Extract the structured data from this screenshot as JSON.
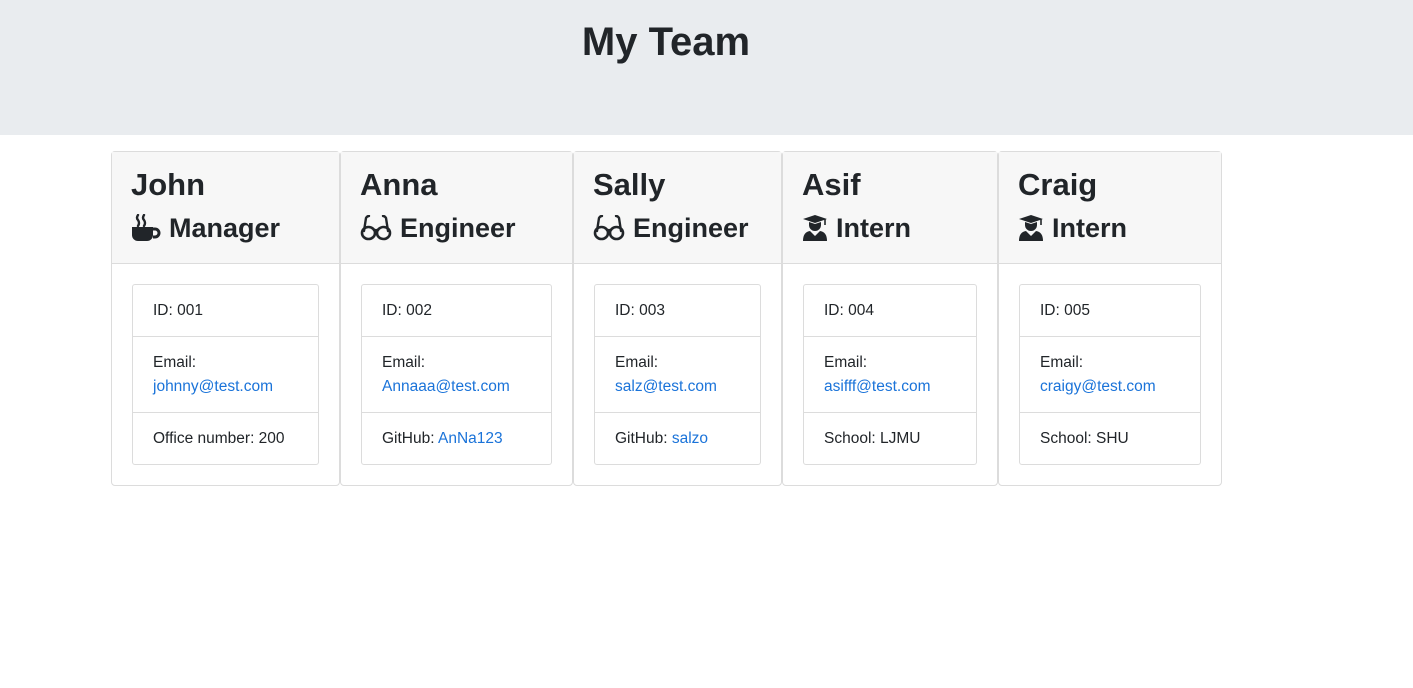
{
  "header": {
    "title": "My Team"
  },
  "team": [
    {
      "name": "John",
      "role": "Manager",
      "icon": "coffee-icon",
      "id_label": "ID: 001",
      "email_label": "Email:",
      "email": "johnny@test.com",
      "extra_label": "Office number: 200",
      "extra_link": ""
    },
    {
      "name": "Anna",
      "role": "Engineer",
      "icon": "glasses-icon",
      "id_label": "ID: 002",
      "email_label": "Email:",
      "email": "Annaaa@test.com",
      "extra_label": "GitHub: ",
      "extra_link": "AnNa123"
    },
    {
      "name": "Sally",
      "role": "Engineer",
      "icon": "glasses-icon",
      "id_label": "ID: 003",
      "email_label": "Email:",
      "email": "salz@test.com",
      "extra_label": "GitHub: ",
      "extra_link": "salzo"
    },
    {
      "name": "Asif",
      "role": "Intern",
      "icon": "graduate-icon",
      "id_label": "ID: 004",
      "email_label": "Email:",
      "email": "asifff@test.com",
      "extra_label": "School: LJMU",
      "extra_link": ""
    },
    {
      "name": "Craig",
      "role": "Intern",
      "icon": "graduate-icon",
      "id_label": "ID: 005",
      "email_label": "Email:",
      "email": "craigy@test.com",
      "extra_label": "School: SHU",
      "extra_link": ""
    }
  ]
}
